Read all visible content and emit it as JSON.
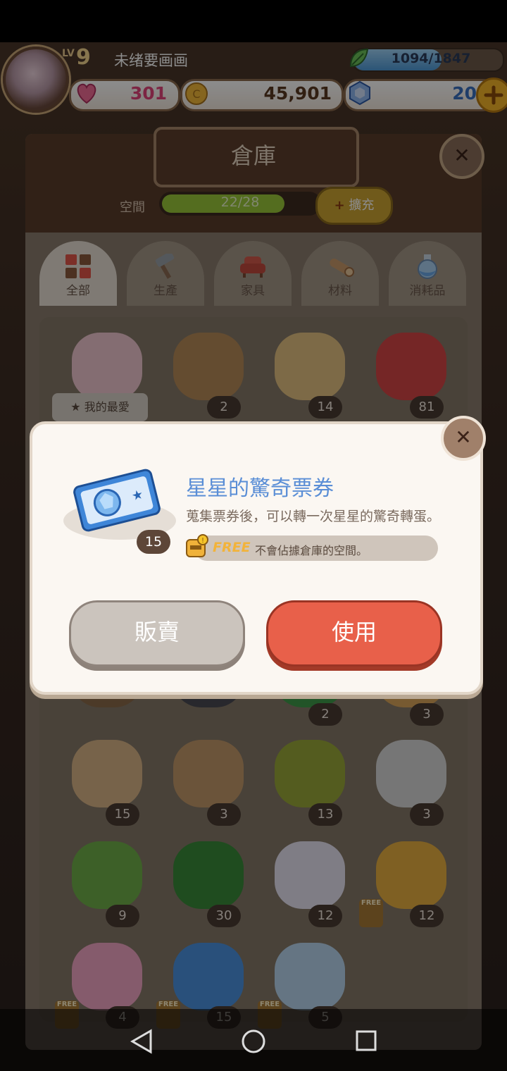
{
  "hud": {
    "level_label": "LV",
    "level": "9",
    "player_name": "未绪要画画",
    "xp": "1094/1847",
    "xp_fraction": 0.59,
    "hearts": "301",
    "coins": "45,901",
    "gems": "20",
    "add_icon": "plus-icon"
  },
  "warehouse": {
    "title": "倉庫",
    "space_label": "空間",
    "space_value": "22/28",
    "space_fraction": 0.786,
    "expand_label": "擴充",
    "tabs": [
      {
        "label": "全部",
        "icon": "grid-icon",
        "active": true
      },
      {
        "label": "生產",
        "icon": "hammer-icon",
        "active": false
      },
      {
        "label": "家具",
        "icon": "armchair-icon",
        "active": false
      },
      {
        "label": "材料",
        "icon": "log-icon",
        "active": false
      },
      {
        "label": "消耗品",
        "icon": "potion-icon",
        "active": false
      }
    ],
    "favorite_label": "我的最愛",
    "free_label": "FREE",
    "items": [
      {
        "icon": "cake-stand-icon",
        "count": ""
      },
      {
        "icon": "basket-icon",
        "count": "2"
      },
      {
        "icon": "wheat-icon",
        "count": "14"
      },
      {
        "icon": "strawberry-icon",
        "count": "81"
      },
      {
        "icon": "dirt-icon",
        "count": ""
      },
      {
        "icon": "coal-icon",
        "count": ""
      },
      {
        "icon": "leaf-icon",
        "count": "2"
      },
      {
        "icon": "straw-icon",
        "count": "3"
      },
      {
        "icon": "log-icon",
        "count": "15"
      },
      {
        "icon": "plank-icon",
        "count": "3"
      },
      {
        "icon": "nuts-icon",
        "count": "13"
      },
      {
        "icon": "pebbles-icon",
        "count": "3"
      },
      {
        "icon": "sapling-icon",
        "count": "9"
      },
      {
        "icon": "vine-icon",
        "count": "30"
      },
      {
        "icon": "rainbow-bag-icon",
        "count": "12"
      },
      {
        "icon": "gold-ticket-icon",
        "count": "12"
      },
      {
        "icon": "heart-ticket-icon",
        "count": "4"
      },
      {
        "icon": "star-ticket-icon",
        "count": "15"
      },
      {
        "icon": "gem-basket-icon",
        "count": "5"
      }
    ]
  },
  "dialog": {
    "item_name": "星星的驚奇票券",
    "description": "蒐集票券後，可以轉一次星星的驚奇轉蛋。",
    "quantity": "15",
    "free_word": "FREE",
    "free_description": "不會佔據倉庫的空間。",
    "sell_label": "販賣",
    "use_label": "使用"
  },
  "colors": {
    "accent_blue": "#5a8ed6",
    "use_button": "#e8604a",
    "sell_button": "#cbc4bd",
    "panel_brown": "#5a3c2a"
  }
}
